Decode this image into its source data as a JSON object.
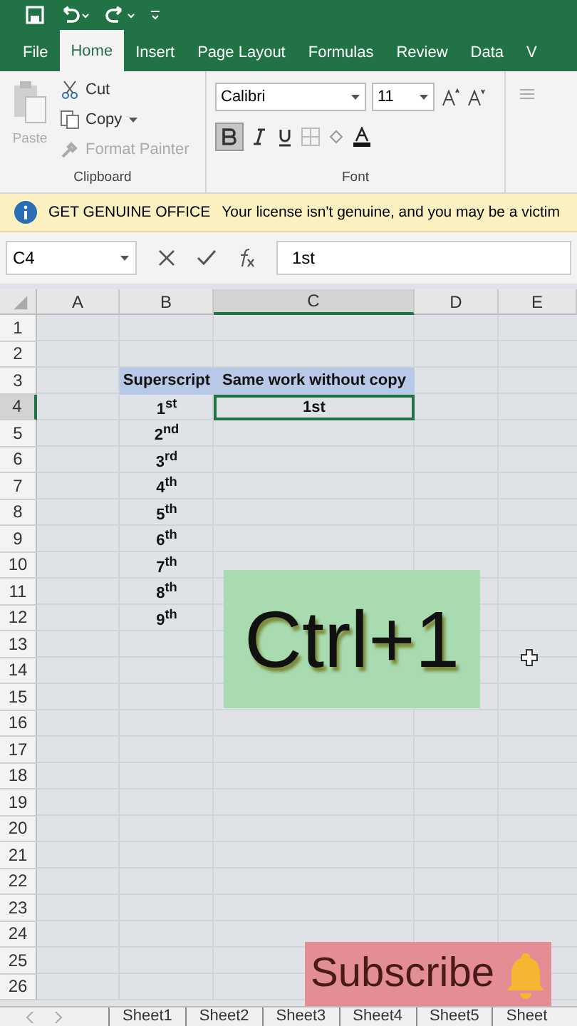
{
  "ribbon_tabs": [
    {
      "label": "File",
      "selected": false
    },
    {
      "label": "Home",
      "selected": true
    },
    {
      "label": "Insert",
      "selected": false
    },
    {
      "label": "Page Layout",
      "selected": false
    },
    {
      "label": "Formulas",
      "selected": false
    },
    {
      "label": "Review",
      "selected": false
    },
    {
      "label": "Data",
      "selected": false
    },
    {
      "label": "V",
      "selected": false
    }
  ],
  "clipboard": {
    "paste": "Paste",
    "cut": "Cut",
    "copy": "Copy",
    "format_painter": "Format Painter",
    "group": "Clipboard"
  },
  "font": {
    "family": "Calibri",
    "size": "11",
    "bold": true,
    "group": "Font"
  },
  "notice": {
    "title": "GET GENUINE OFFICE",
    "message": "Your license isn't genuine, and you may be a victim"
  },
  "formula_bar": {
    "name_box": "C4",
    "value": "1st"
  },
  "columns": [
    {
      "label": "A",
      "selected": false
    },
    {
      "label": "B",
      "selected": false
    },
    {
      "label": "C",
      "selected": true
    },
    {
      "label": "D",
      "selected": false
    },
    {
      "label": "E",
      "selected": false
    }
  ],
  "rows": [
    {
      "number": "1",
      "selected": false
    },
    {
      "number": "2",
      "selected": false
    },
    {
      "number": "3",
      "selected": false,
      "highlighted": true,
      "b": "Superscript",
      "c": "Same work without copy"
    },
    {
      "number": "4",
      "selected": true,
      "b": "1$^{st}$",
      "c": "1st",
      "c_active": true
    },
    {
      "number": "5",
      "selected": false,
      "b": "2$^{nd}$"
    },
    {
      "number": "6",
      "selected": false,
      "b": "3$^{rd}$"
    },
    {
      "number": "7",
      "selected": false,
      "b": "4$^{th}$"
    },
    {
      "number": "8",
      "selected": false,
      "b": "5$^{th}$"
    },
    {
      "number": "9",
      "selected": false,
      "b": "6$^{th}$"
    },
    {
      "number": "10",
      "selected": false,
      "b": "7$^{th}$"
    },
    {
      "number": "11",
      "selected": false,
      "b": "8$^{th}$"
    },
    {
      "number": "12",
      "selected": false,
      "b": "9$^{th}$"
    },
    {
      "number": "13",
      "selected": false
    },
    {
      "number": "14",
      "selected": false
    },
    {
      "number": "15",
      "selected": false
    },
    {
      "number": "16",
      "selected": false
    },
    {
      "number": "17",
      "selected": false
    },
    {
      "number": "18",
      "selected": false
    },
    {
      "number": "19",
      "selected": false
    },
    {
      "number": "20",
      "selected": false
    },
    {
      "number": "21",
      "selected": false
    },
    {
      "number": "22",
      "selected": false
    },
    {
      "number": "23",
      "selected": false
    },
    {
      "number": "24",
      "selected": false
    },
    {
      "number": "25",
      "selected": false
    },
    {
      "number": "26",
      "selected": false
    }
  ],
  "overlays": [
    {
      "kind": "caption",
      "text": "Ctrl+1"
    },
    {
      "kind": "subscribe",
      "text": "Subscribe"
    }
  ],
  "sheet_tabs": [
    {
      "label": "Sheet1",
      "selected": false
    },
    {
      "label": "Sheet2",
      "selected": false
    },
    {
      "label": "Sheet3",
      "selected": false
    },
    {
      "label": "Sheet4",
      "selected": false
    },
    {
      "label": "Sheet5",
      "selected": false
    },
    {
      "label": "Sheet",
      "selected": false
    }
  ]
}
